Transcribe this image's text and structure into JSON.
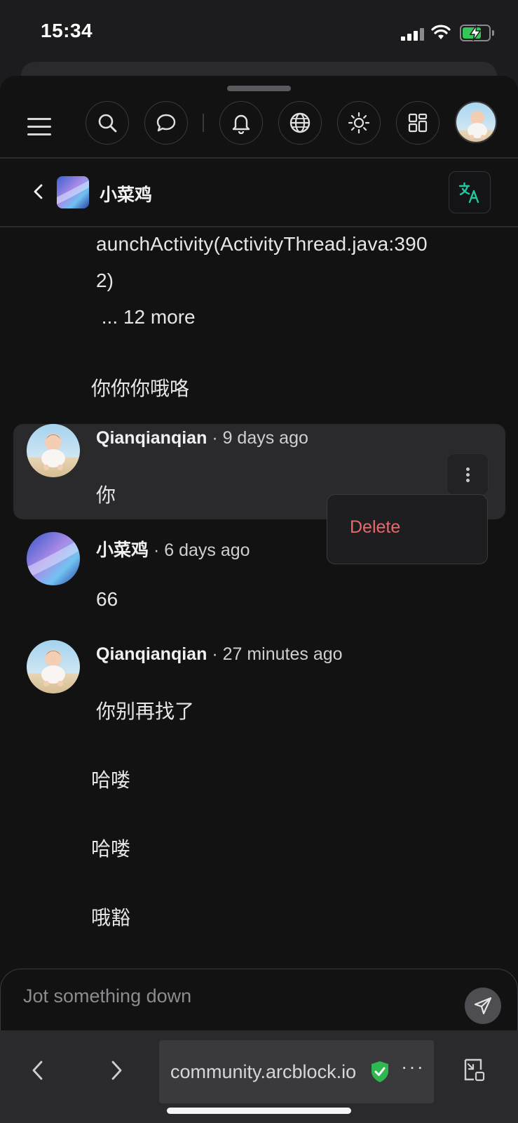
{
  "status_bar": {
    "time": "15:34"
  },
  "toolbar": {
    "buttons": [
      "search",
      "chat",
      "notifications",
      "language",
      "theme",
      "apps"
    ]
  },
  "chat_header": {
    "title": "小菜鸡",
    "back_icon": "chevron-left-icon",
    "translate_icon": "translate-icon"
  },
  "messages": {
    "prev_lines": [
      "aunchActivity(ActivityThread.java:390",
      "2)",
      " ... 12 more",
      "你你你哦咯"
    ],
    "items": [
      {
        "author": "Qianqianqian",
        "time": "· 9 days ago",
        "text": "你"
      },
      {
        "author": "小菜鸡",
        "time": "· 6 days ago",
        "text": "66"
      },
      {
        "author": "Qianqianqian",
        "time": "· 27 minutes ago",
        "lines": [
          "你别再找了",
          "哈喽",
          "哈喽",
          "哦豁"
        ]
      }
    ],
    "context_menu": {
      "delete_label": "Delete"
    }
  },
  "composer": {
    "placeholder": "Jot something down"
  },
  "browser": {
    "url": "community.arcblock.io"
  },
  "colors": {
    "accent": "#1ec9a0",
    "danger": "#e76a6a",
    "secure": "#34c759"
  }
}
